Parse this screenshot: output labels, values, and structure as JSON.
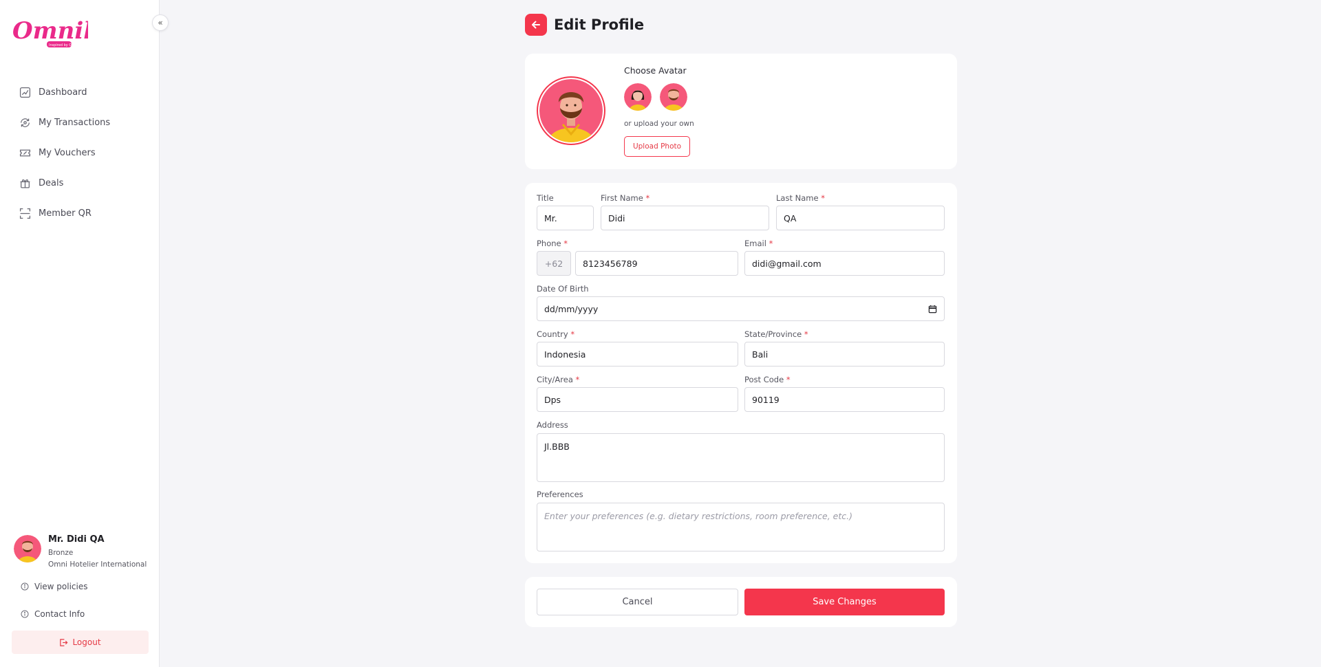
{
  "brand": {
    "logo_text": "Omnih",
    "logo_tagline": "Inspired by Omnih",
    "accent_color": "#f4364c"
  },
  "sidebar": {
    "collapse_icon": "«",
    "items": [
      {
        "label": "Dashboard",
        "icon": "chart-icon"
      },
      {
        "label": "My Transactions",
        "icon": "transactions-icon"
      },
      {
        "label": "My Vouchers",
        "icon": "voucher-icon"
      },
      {
        "label": "Deals",
        "icon": "deals-icon"
      },
      {
        "label": "Member QR",
        "icon": "qr-icon"
      }
    ],
    "user": {
      "name": "Mr. Didi QA",
      "tier": "Bronze",
      "company": "Omni Hotelier International"
    },
    "view_policies": "View policies",
    "contact_info": "Contact Info",
    "logout": "Logout"
  },
  "header": {
    "title": "Edit Profile"
  },
  "avatar_section": {
    "choose_label": "Choose Avatar",
    "upload_hint": "or upload your own",
    "upload_button": "Upload Photo"
  },
  "form": {
    "title_label": "Title",
    "title_value": "Mr.",
    "first_name_label": "First Name",
    "first_name_value": "Didi",
    "last_name_label": "Last Name",
    "last_name_value": "QA",
    "phone_label": "Phone",
    "phone_prefix": "+62",
    "phone_value": "8123456789",
    "email_label": "Email",
    "email_value": "didi@gmail.com",
    "dob_label": "Date Of Birth",
    "dob_placeholder": "dd/mm/yyyy",
    "country_label": "Country",
    "country_value": "Indonesia",
    "state_label": "State/Province",
    "state_value": "Bali",
    "city_label": "City/Area",
    "city_value": "Dps",
    "postcode_label": "Post Code",
    "postcode_value": "90119",
    "address_label": "Address",
    "address_value": "Jl.BBB",
    "preferences_label": "Preferences",
    "preferences_placeholder": "Enter your preferences (e.g. dietary restrictions, room preference, etc.)",
    "required_mark": "*"
  },
  "actions": {
    "cancel": "Cancel",
    "save": "Save Changes"
  }
}
